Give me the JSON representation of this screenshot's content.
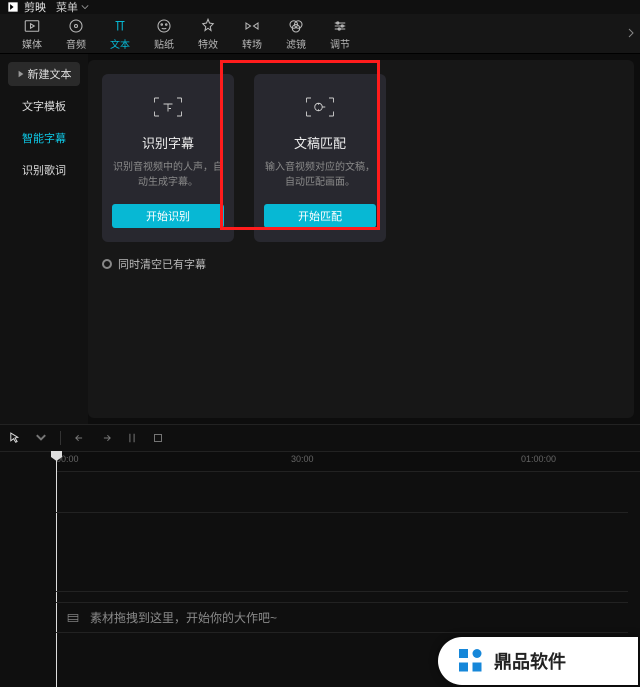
{
  "titlebar": {
    "app_name": "剪映",
    "menu_label": "菜单"
  },
  "tabs": [
    {
      "label": "媒体"
    },
    {
      "label": "音频"
    },
    {
      "label": "文本"
    },
    {
      "label": "贴纸"
    },
    {
      "label": "特效"
    },
    {
      "label": "转场"
    },
    {
      "label": "滤镜"
    },
    {
      "label": "调节"
    }
  ],
  "sidebar": {
    "items": [
      {
        "label": "新建文本"
      },
      {
        "label": "文字模板"
      },
      {
        "label": "智能字幕"
      },
      {
        "label": "识别歌词"
      }
    ]
  },
  "cards": [
    {
      "title": "识别字幕",
      "desc": "识别音视频中的人声，自动生成字幕。",
      "button": "开始识别"
    },
    {
      "title": "文稿匹配",
      "desc": "输入音视频对应的文稿，自动匹配画面。",
      "button": "开始匹配"
    }
  ],
  "clear_existing": "同时清空已有字幕",
  "timeline": {
    "marks": [
      "00:00",
      "30:00",
      "01:00:00"
    ],
    "drop_hint": "素材拖拽到这里，开始你的大作吧~"
  },
  "badge": {
    "brand": "鼎品软件"
  }
}
